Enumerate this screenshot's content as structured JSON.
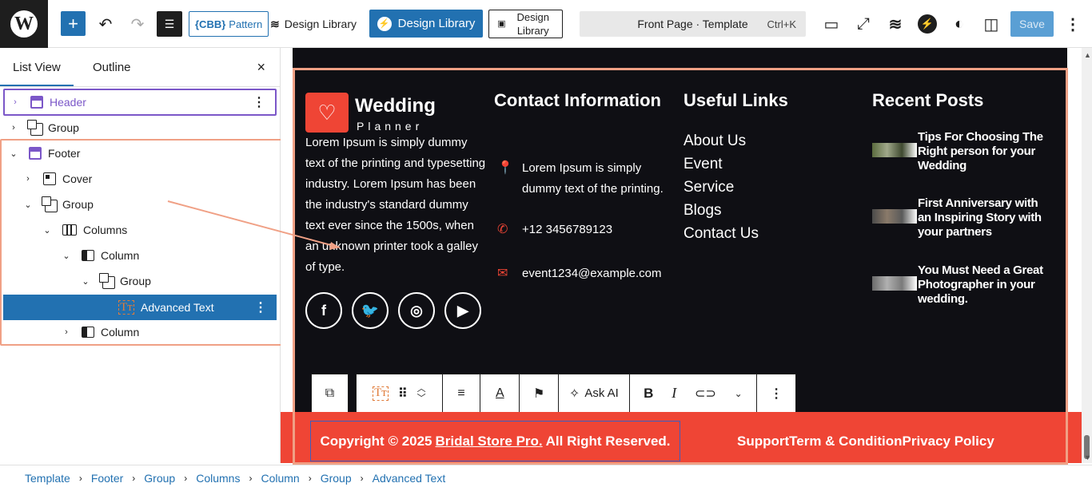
{
  "topbar": {
    "pattern_label": "Pattern",
    "pattern_prefix": "{CBB}",
    "design_library_1": "Design Library",
    "design_library_2": "Design Library",
    "design_library_3": "Design Library",
    "command_title": "Front Page · Template",
    "command_shortcut": "Ctrl+K",
    "save_label": "Save"
  },
  "sidebar": {
    "tab_list": "List View",
    "tab_outline": "Outline",
    "close": "×",
    "items": [
      {
        "label": "Header"
      },
      {
        "label": "Group"
      },
      {
        "label": "Footer"
      },
      {
        "label": "Cover"
      },
      {
        "label": "Group"
      },
      {
        "label": "Columns"
      },
      {
        "label": "Column"
      },
      {
        "label": "Group"
      },
      {
        "label": "Advanced Text"
      },
      {
        "label": "Column"
      }
    ]
  },
  "footer": {
    "logo_title": "Wedding",
    "logo_sub": "Planner",
    "about": "Lorem Ipsum is simply dummy text of the printing and typesetting industry. Lorem Ipsum has been the industry's standard dummy text ever since the 1500s, when an unknown printer took a galley of type.",
    "contact_title": "Contact Information",
    "contact_address": "Lorem Ipsum is simply dummy text of the printing.",
    "contact_phone": "+12 3456789123",
    "contact_email": "event1234@example.com",
    "links_title": "Useful Links",
    "links": [
      "About Us",
      "Event",
      "Service",
      "Blogs",
      "Contact Us"
    ],
    "posts_title": "Recent Posts",
    "posts": [
      "Tips For Choosing The Right person for your Wedding",
      "First Anniversary with an Inspiring Story with your partners",
      "You Must Need a Great Photographer in your wedding."
    ],
    "copyright_prefix": "Copyright © 2025",
    "copyright_link": "Bridal Store Pro.",
    "copyright_suffix": "All Right Reserved.",
    "bottom_links": "SupportTerm & ConditionPrivacy Policy"
  },
  "block_toolbar": {
    "ask_ai": "Ask AI"
  },
  "breadcrumbs": [
    "Template",
    "Footer",
    "Group",
    "Columns",
    "Column",
    "Group",
    "Advanced Text"
  ],
  "colors": {
    "accent": "#2271b1",
    "brand_red": "#ef4535",
    "template_purple": "#7b57c8",
    "highlight": "#f0a085",
    "canvas_bg": "#0f0f14"
  }
}
